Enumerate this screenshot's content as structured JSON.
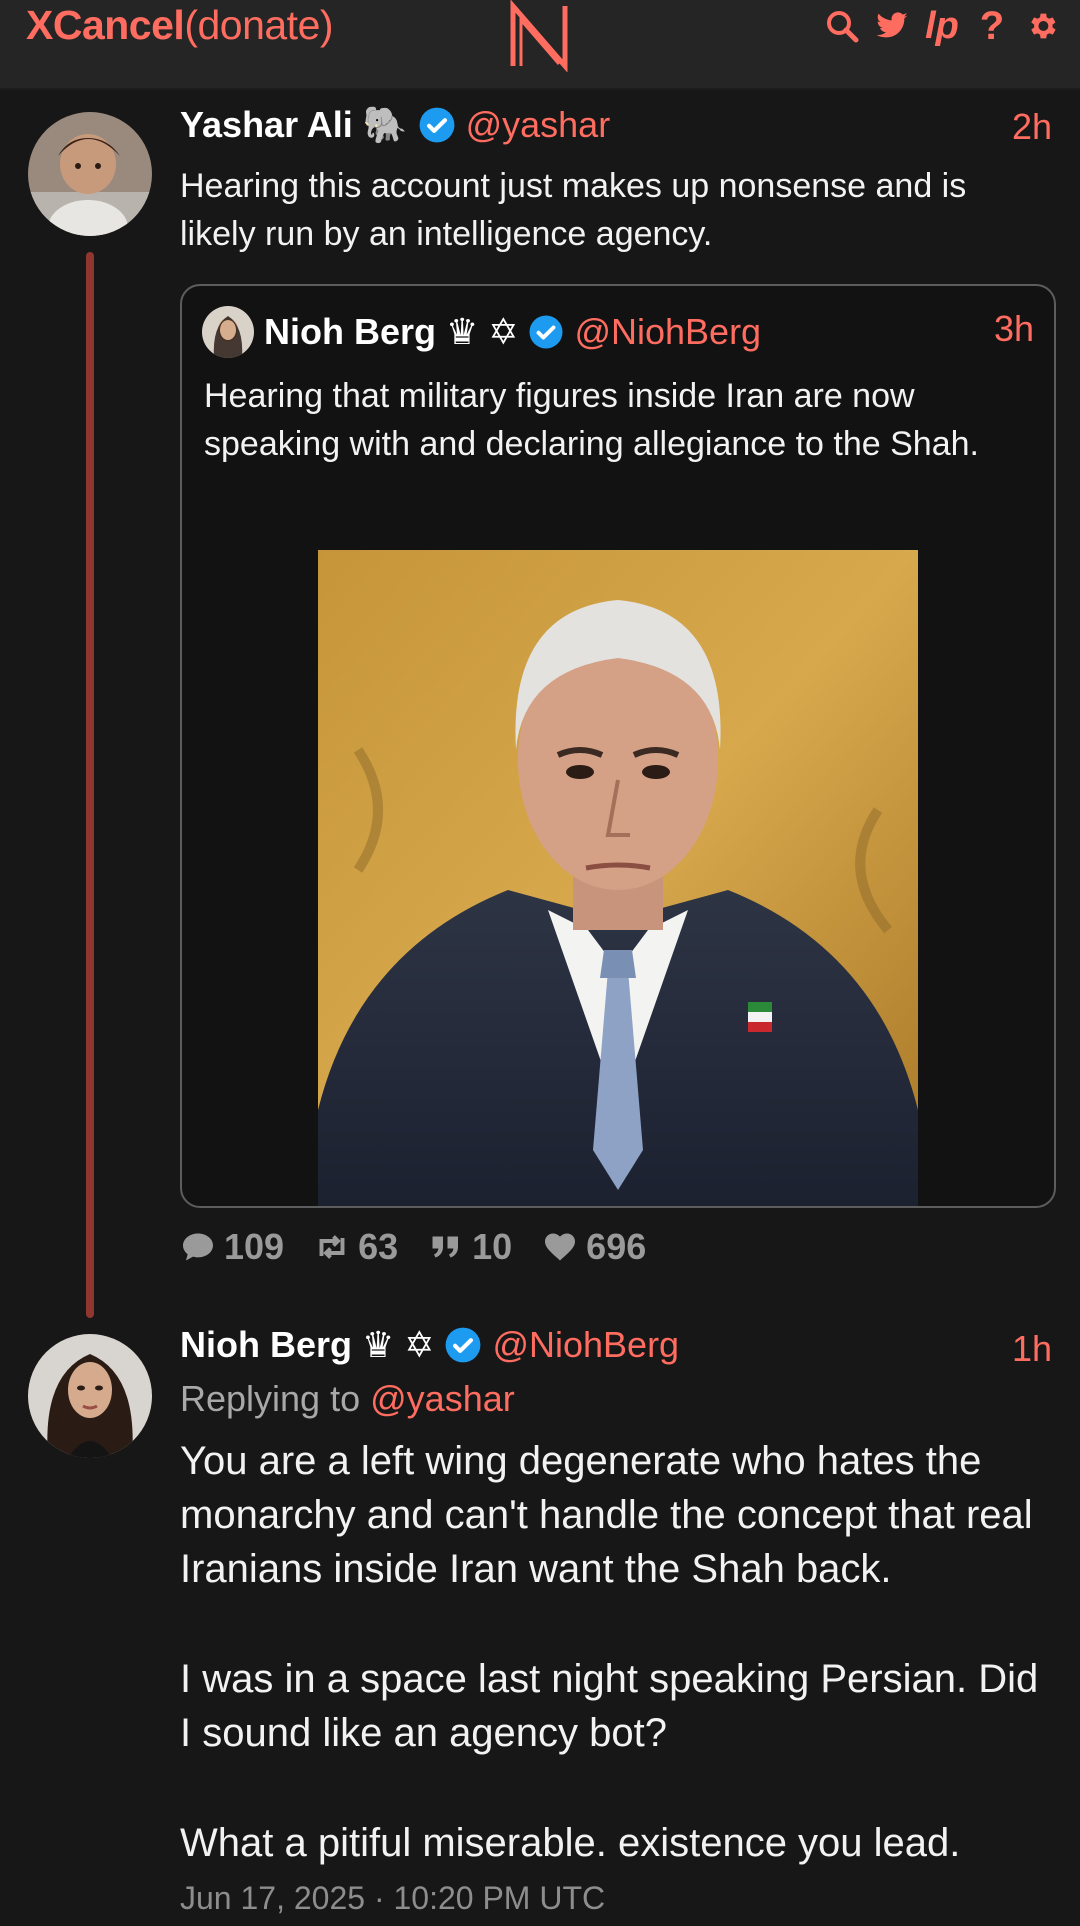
{
  "header": {
    "brand": "XCancel",
    "donate": "(donate)",
    "logo_icon": "n-logo-icon",
    "icons": [
      "search-icon",
      "twitter-bird-icon",
      "lp-icon",
      "help-icon",
      "gear-icon"
    ],
    "lp_label": "lp",
    "help_label": "?"
  },
  "tweet_main": {
    "name": "Yashar Ali 🐘",
    "handle": "@yashar",
    "time": "2h",
    "text": "Hearing this account just makes up nonsense and is likely run by an intelligence agency.",
    "quote": {
      "name": "Nioh Berg ♛ ✡",
      "handle": "@NiohBerg",
      "time": "3h",
      "text": "Hearing that military figures inside Iran are now speaking with and declaring allegiance to the Shah."
    },
    "stats": {
      "replies": "109",
      "retweets": "63",
      "quotes": "10",
      "likes": "696"
    }
  },
  "tweet_reply": {
    "name": "Nioh Berg ♛ ✡",
    "handle": "@NiohBerg",
    "time": "1h",
    "replying_prefix": "Replying to",
    "replying_handle": "@yashar",
    "paragraphs": [
      "You are a left wing degenerate who hates the monarchy and can't handle the concept that real Iranians inside Iran want the Shah back.",
      "I was in a space last night speaking Persian. Did I sound like an agency bot?",
      "What a pitiful miserable. existence you lead."
    ],
    "date": "Jun 17, 2025 · 10:20 PM UTC"
  },
  "colors": {
    "accent": "#ff6c60",
    "background": "#171717",
    "thread_line": "#8f3630",
    "verified": "#1d9bf0"
  }
}
